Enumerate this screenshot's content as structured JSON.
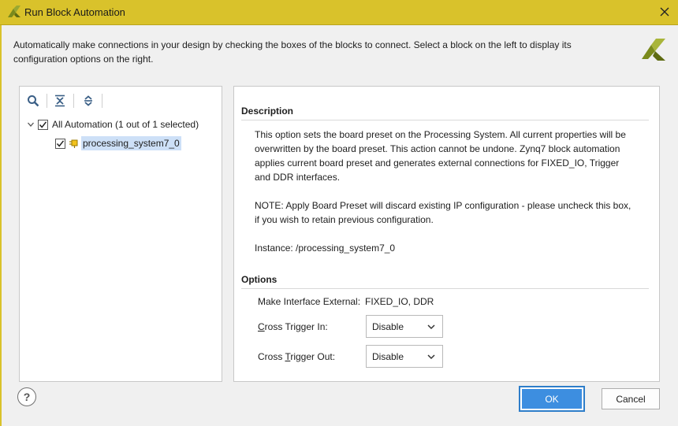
{
  "window": {
    "title": "Run Block Automation",
    "close_icon": "close-icon"
  },
  "intro": {
    "line1": "Automatically make connections in your design by checking the boxes of the blocks to connect. Select a block on the left to display its",
    "line2": "configuration options on the right."
  },
  "toolbar": {
    "icons": [
      "search-icon",
      "collapse-all-icon",
      "expand-all-icon"
    ]
  },
  "tree": {
    "root_label": "All Automation (1 out of 1 selected)",
    "root_checked": true,
    "child_label": "processing_system7_0",
    "child_checked": true
  },
  "description": {
    "header": "Description",
    "para1_lines": [
      "This option sets the board preset on the Processing System. All current properties will be",
      "overwritten by the board preset. This action cannot be undone. Zynq7 block automation",
      "applies current board preset and generates external connections for FIXED_IO, Trigger",
      "and DDR interfaces."
    ],
    "para2_lines": [
      "NOTE: Apply Board Preset will discard existing IP configuration - please uncheck this box,",
      "if you wish to retain previous configuration."
    ],
    "instance": "Instance: /processing_system7_0"
  },
  "options": {
    "header": "Options",
    "make_external_label": "Make Interface External:",
    "make_external_value": "FIXED_IO, DDR",
    "cross_trigger_in": {
      "label_prefix": "",
      "label_mnemonic": "C",
      "label_rest": "ross Trigger In:",
      "value": "Disable"
    },
    "cross_trigger_out": {
      "label_prefix": "Cross ",
      "label_mnemonic": "T",
      "label_rest": "rigger Out:",
      "value": "Disable"
    }
  },
  "buttons": {
    "help": "?",
    "ok": "OK",
    "cancel": "Cancel"
  },
  "colors": {
    "title_bar": "#d9c22b",
    "accent_blue": "#3d8ee0",
    "selection": "#cde0f7"
  }
}
